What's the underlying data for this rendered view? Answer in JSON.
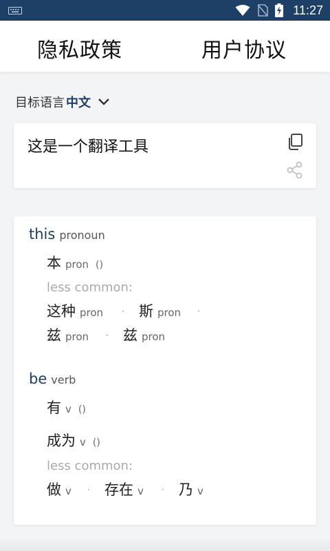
{
  "status_bar": {
    "time": "11:27",
    "icons": [
      "keyboard-icon",
      "wifi-icon",
      "no-sim-icon",
      "battery-charging-icon"
    ]
  },
  "header": {
    "privacy_label": "隐私政策",
    "agreement_label": "用户协议"
  },
  "target_language": {
    "label": "目标语言",
    "value": "中文"
  },
  "input": {
    "text": "这是一个翻译工具",
    "icons": [
      "copy-icon",
      "share-icon"
    ]
  },
  "dictionary": {
    "entries": [
      {
        "word": "this",
        "pos": "pronoun",
        "main": {
          "text": "本",
          "pos": "pron",
          "paren": "()"
        },
        "less_common_label": "less common:",
        "less_common": [
          {
            "text": "这种",
            "pos": "pron"
          },
          {
            "text": "斯",
            "pos": "pron"
          },
          {
            "text": "兹",
            "pos": "pron"
          },
          {
            "text": "兹",
            "pos": "pron"
          }
        ]
      },
      {
        "word": "be",
        "pos": "verb",
        "main": [
          {
            "text": "有",
            "pos": "v",
            "paren": "()"
          },
          {
            "text": "成为",
            "pos": "v",
            "paren": "()"
          }
        ],
        "less_common_label": "less common:",
        "less_common": [
          {
            "text": "做",
            "pos": "v"
          },
          {
            "text": "存在",
            "pos": "v"
          },
          {
            "text": "乃",
            "pos": "v"
          }
        ]
      }
    ],
    "separator": "·"
  },
  "colors": {
    "status_bar": "#1e3f66",
    "accent": "#1e3f66",
    "background": "#f3f4f6",
    "card": "#ffffff"
  }
}
